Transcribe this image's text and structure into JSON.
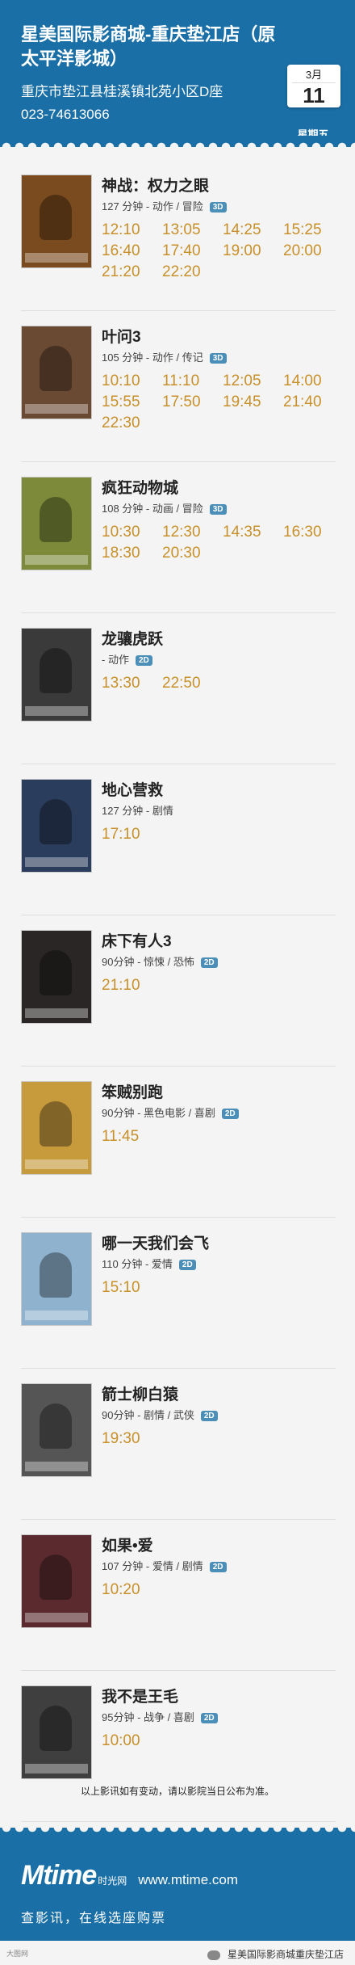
{
  "header": {
    "cinema_name": "星美国际影商城-重庆垫江店（原太平洋影城）",
    "address": "重庆市垫江县桂溪镇北苑小区D座",
    "phone": "023-74613066",
    "date_month": "3月",
    "date_day": "11",
    "weekday": "星期五"
  },
  "movies": [
    {
      "title": "神战：权力之眼",
      "meta": "127 分钟 - 动作 / 冒险",
      "format": "3D",
      "poster_color": "#7a4b1e",
      "times": [
        "12:10",
        "13:05",
        "14:25",
        "15:25",
        "16:40",
        "17:40",
        "19:00",
        "20:00",
        "21:20",
        "22:20"
      ]
    },
    {
      "title": "叶问3",
      "meta": "105 分钟 - 动作 / 传记",
      "format": "3D",
      "poster_color": "#6b4a33",
      "times": [
        "10:10",
        "11:10",
        "12:05",
        "14:00",
        "15:55",
        "17:50",
        "19:45",
        "21:40",
        "22:30"
      ]
    },
    {
      "title": "疯狂动物城",
      "meta": "108 分钟 - 动画 / 冒险",
      "format": "3D",
      "poster_color": "#7c8a3a",
      "times": [
        "10:30",
        "12:30",
        "14:35",
        "16:30",
        "18:30",
        "20:30"
      ]
    },
    {
      "title": "龙骧虎跃",
      "meta": "- 动作",
      "format": "2D",
      "poster_color": "#3a3a3a",
      "times": [
        "13:30",
        "22:50"
      ]
    },
    {
      "title": "地心营救",
      "meta": "127 分钟 - 剧情",
      "format": "",
      "poster_color": "#2b3d5c",
      "times": [
        "17:10"
      ]
    },
    {
      "title": "床下有人3",
      "meta": "90分钟 - 惊悚 / 恐怖",
      "format": "2D",
      "poster_color": "#2a2626",
      "times": [
        "21:10"
      ]
    },
    {
      "title": "笨贼别跑",
      "meta": "90分钟 - 黑色电影 / 喜剧",
      "format": "2D",
      "poster_color": "#c79a3c",
      "times": [
        "11:45"
      ]
    },
    {
      "title": "哪一天我们会飞",
      "meta": "110 分钟 - 爱情",
      "format": "2D",
      "poster_color": "#8fb3cf",
      "times": [
        "15:10"
      ]
    },
    {
      "title": "箭士柳白猿",
      "meta": "90分钟 - 剧情 / 武侠",
      "format": "2D",
      "poster_color": "#555555",
      "times": [
        "19:30"
      ]
    },
    {
      "title": "如果•爱",
      "meta": "107 分钟 - 爱情 / 剧情",
      "format": "2D",
      "poster_color": "#5a2a2e",
      "times": [
        "10:20"
      ]
    },
    {
      "title": "我不是王毛",
      "meta": "95分钟 - 战争 / 喜剧",
      "format": "2D",
      "poster_color": "#3f3f3f",
      "times": [
        "10:00"
      ]
    }
  ],
  "disclaimer": "以上影讯如有变动，请以影院当日公布为准。",
  "footer": {
    "logo_main": "Mtime",
    "logo_sub": "时光网",
    "url": "www.mtime.com",
    "tagline": "查影讯，在线选座购票",
    "credit_left": "大图网",
    "credit_right": "星美国际影商城重庆垫江店"
  }
}
